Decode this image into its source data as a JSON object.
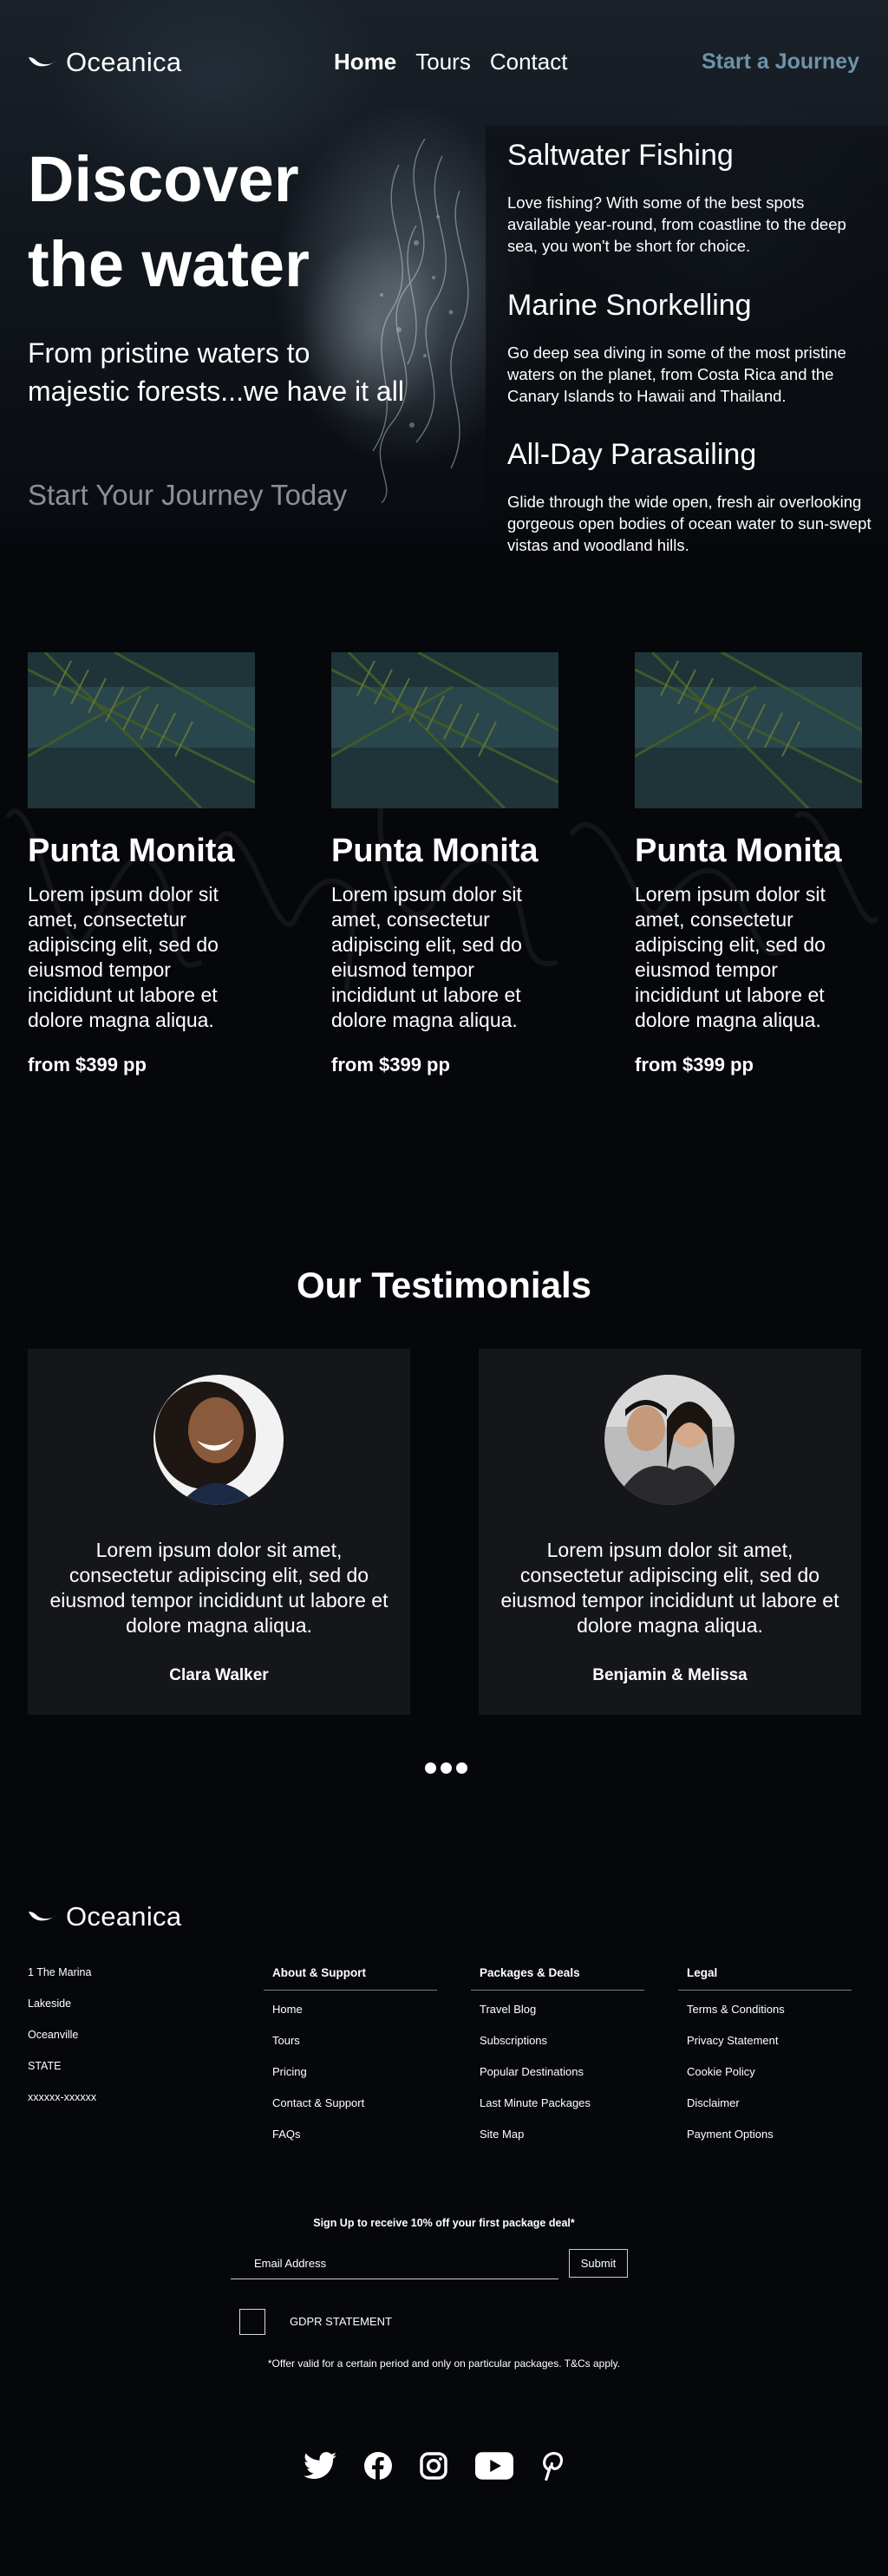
{
  "brand": {
    "name": "Oceanica"
  },
  "nav": {
    "items": [
      {
        "label": "Home",
        "active": true
      },
      {
        "label": "Tours",
        "active": false
      },
      {
        "label": "Contact",
        "active": false
      }
    ],
    "cta": "Start a Journey"
  },
  "hero": {
    "title": "Discover the water",
    "subtitle": "From pristine waters to majestic forests...we have it all",
    "link": "Start Your Journey Today"
  },
  "features": [
    {
      "title": "Saltwater Fishing",
      "text": "Love fishing? With some of the best spots available year-round, from coastline to the deep sea, you won't be short for choice."
    },
    {
      "title": "Marine Snorkelling",
      "text": "Go deep sea diving in some of the most pristine waters on the planet, from Costa Rica and the Canary Islands to Hawaii and Thailand."
    },
    {
      "title": "All-Day Parasailing",
      "text": "Glide through the wide open, fresh air overlooking gorgeous open bodies of ocean water to sun-swept vistas and woodland hills."
    }
  ],
  "destinations": [
    {
      "title": "Punta Monita",
      "text": "Lorem ipsum dolor sit amet, consectetur adipiscing elit, sed do eiusmod tempor incididunt ut labore et dolore magna aliqua.",
      "price": "from $399 pp"
    },
    {
      "title": "Punta Monita",
      "text": "Lorem ipsum dolor sit amet, consectetur adipiscing elit, sed do eiusmod tempor incididunt ut labore et dolore magna aliqua.",
      "price": "from $399 pp"
    },
    {
      "title": "Punta Monita",
      "text": "Lorem ipsum dolor sit amet, consectetur adipiscing elit, sed do eiusmod tempor incididunt ut labore et dolore magna aliqua.",
      "price": "from $399 pp"
    }
  ],
  "testimonials": {
    "title": "Our Testimonials",
    "items": [
      {
        "quote": "Lorem ipsum dolor sit amet, consectetur adipiscing elit, sed do eiusmod tempor incididunt ut labore et dolore magna aliqua.",
        "name": "Clara Walker"
      },
      {
        "quote": "Lorem ipsum dolor sit amet, consectetur adipiscing elit, sed do eiusmod tempor incididunt ut labore et dolore magna aliqua.",
        "name": "Benjamin & Melissa"
      }
    ]
  },
  "footer": {
    "address": [
      "1 The Marina",
      "Lakeside",
      "Oceanville",
      "STATE",
      "xxxxxx-xxxxxx"
    ],
    "columns": [
      {
        "heading": "About & Support",
        "links": [
          "Home",
          "Tours",
          "Pricing",
          "Contact & Support",
          "FAQs"
        ]
      },
      {
        "heading": "Packages & Deals",
        "links": [
          "Travel Blog",
          "Subscriptions",
          "Popular Destinations",
          "Last Minute Packages",
          "Site Map"
        ]
      },
      {
        "heading": "Legal",
        "links": [
          "Terms & Conditions",
          "Privacy Statement",
          "Cookie Policy",
          "Disclaimer",
          "Payment Options"
        ]
      }
    ],
    "signup": {
      "title": "Sign Up to receive 10% off your first package deal*",
      "email_placeholder": "Email Address",
      "submit": "Submit",
      "gdpr": "GDPR STATEMENT",
      "offer": "*Offer valid for a certain period and only on particular packages. T&Cs apply."
    },
    "social": [
      "twitter-icon",
      "facebook-icon",
      "instagram-icon",
      "youtube-icon",
      "pinterest-icon"
    ]
  },
  "colors": {
    "background": "#05070b",
    "accent": "#6d93a8",
    "muted": "#8b9097",
    "card": "#16181c"
  }
}
